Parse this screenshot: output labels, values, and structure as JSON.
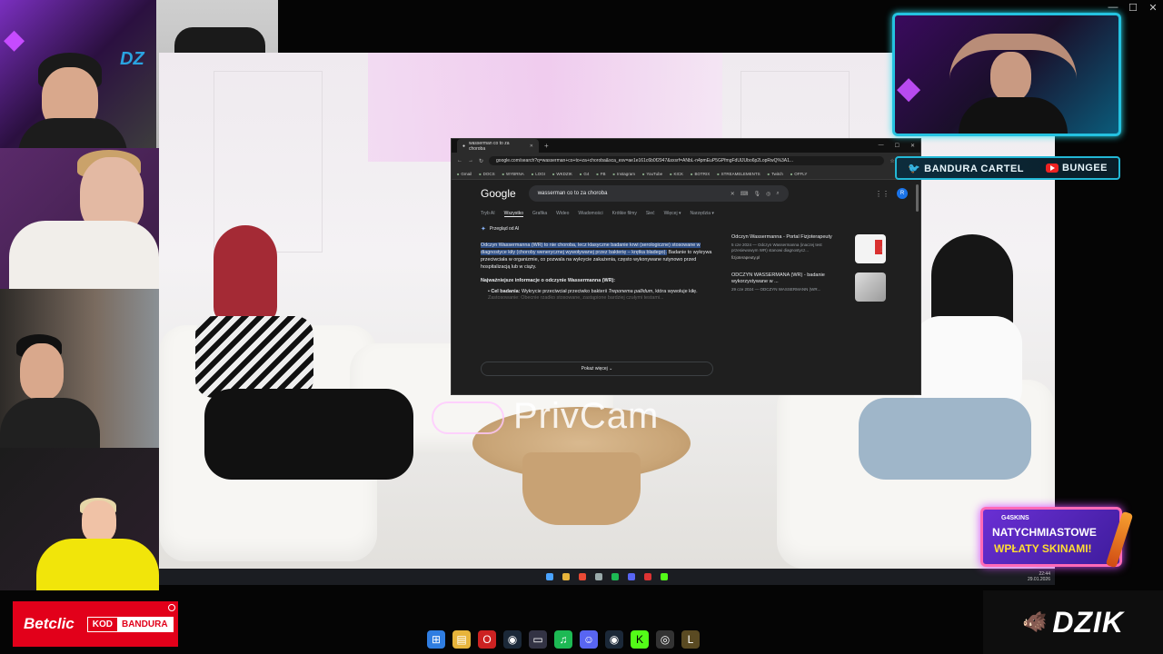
{
  "browser": {
    "tab_title": "wasserman co to za choroba",
    "url": "google.com/search?q=wasserman+co+to+za+choroba&sca_esv=ae1e161c6b0f2947&sxsrf=ANbL-n4pmEuP5GPfmgFdUlJUbo6p2LopRwQ%3A1...",
    "bookmarks": [
      "Gmail",
      "DOCS",
      "WYBRNA",
      "LOGI",
      "WKDZIK",
      "G4",
      "FB",
      "Instagram",
      "YouTube",
      "KICK",
      "BOTRIX",
      "STREAMELEMENTS",
      "Twitch",
      "OFFLY"
    ]
  },
  "google": {
    "logo": "Google",
    "query": "wasserman co to za choroba",
    "nav": [
      "Tryb AI",
      "Wszystko",
      "Grafika",
      "Wideo",
      "Wiadomości",
      "Krótkie filmy",
      "Sieć",
      "Więcej ▾",
      "Narzędzia ▾"
    ],
    "ai_overview_label": "Przegląd od AI",
    "ai_highlight": "Odczyn Wassermanna (WR) to nie choroba, lecz klasyczne badanie krwi (serologiczne) stosowane w diagnostyce kiły (choroby wenerycznej wywoływanej przez bakterię – krętka bladego).",
    "ai_rest": " Badanie to wykrywa przeciwciała w organizmie, co pozwala na wykrycie zakażenia, często wykonywane rutynowo przed hospitalizacją lub w ciąży.",
    "ai_subhead": "Najważniejsze informacje o odczynie Wassermanna (WR):",
    "ai_bullet_label": "Cel badania:",
    "ai_bullet_text": " Wykrycie przeciwciał przeciwko bakterii ",
    "ai_bullet_italic": "Treponema pallidum",
    "ai_bullet_end": ", która wywołuje kiłę.",
    "ai_fade": "Zastosowanie: Obecnie rzadko stosowane, zastąpione bardziej czułymi testami...",
    "show_more": "Pokaż więcej ⌄",
    "sources": [
      {
        "title": "Odczyn Wassermanna - Portal Fizjoterapeuty",
        "desc": "5 cze 2024 — Odczyn Wassermanna (inaczej test przesiewowym WR) stanowi diagnostycz...",
        "site": "fizjoterapeuty.pl"
      },
      {
        "title": "ODCZYN WASSERMANA (WR) - badanie wykorzystywane w ...",
        "desc": "29 cze 2024 — ODCZYN WASSERMANN (WR...",
        "site": ""
      }
    ]
  },
  "video": {
    "watermark": "PrivCam"
  },
  "inner_clock": {
    "time": "22:44",
    "date": "29.01.2026"
  },
  "social": {
    "twitter": "BANDURA CARTEL",
    "youtube": "BUNGEE"
  },
  "promo": {
    "brand": "G4SKINS",
    "line1": "NATYCHMIASTOWE",
    "line2": "WPŁATY SKINAMI!"
  },
  "betclic": {
    "name": "Betclic",
    "code_label": "KOD",
    "code_value": "BANDURA"
  },
  "dzik": {
    "mini": "DZ",
    "big": "DZIK"
  }
}
